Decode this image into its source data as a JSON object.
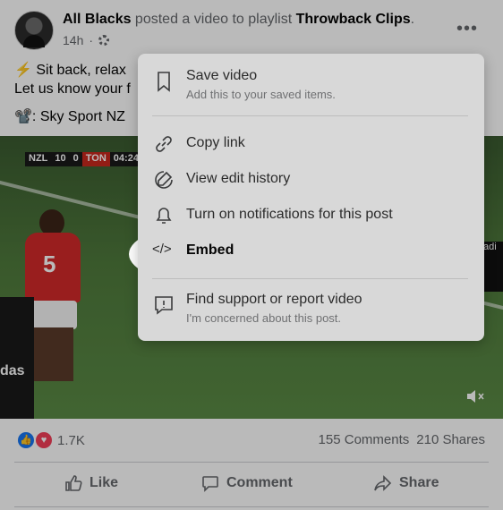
{
  "post": {
    "author": "All Blacks",
    "action_text": " posted a video to playlist ",
    "playlist": "Throwback Clips",
    "period": ".",
    "time": "14h",
    "more_label": "•••",
    "caption_line1_prefix": "⚡ Sit back, relax",
    "caption_line2": "Let us know your f",
    "credit_text": ": Sky Sport NZ",
    "credit_icon": "📽️"
  },
  "video": {
    "scoreboard": {
      "team1": "NZL",
      "score1": "10",
      "score2": "0",
      "team2": "TON",
      "clock": "04:24"
    },
    "player_number": "5",
    "ad_left": "das",
    "ad_right": "adi"
  },
  "footer": {
    "reaction_count": "1.7K",
    "comments": "155 Comments",
    "shares": "210 Shares",
    "like_label": "Like",
    "comment_label": "Comment",
    "share_label": "Share"
  },
  "menu": {
    "save": {
      "label": "Save video",
      "sub": "Add this to your saved items."
    },
    "copy_link": {
      "label": "Copy link"
    },
    "edit_history": {
      "label": "View edit history"
    },
    "notifications": {
      "label": "Turn on notifications for this post"
    },
    "embed": {
      "label": "Embed",
      "icon_glyph": "</>"
    },
    "report": {
      "label": "Find support or report video",
      "sub": "I'm concerned about this post."
    }
  },
  "icons": {
    "save": "bookmark-icon",
    "copy_link": "link-icon",
    "edit_history": "edit-history-icon",
    "notifications": "bell-icon",
    "embed": "code-icon",
    "report": "report-icon"
  },
  "colors": {
    "like_blue": "#1877f2",
    "love_red": "#f33e58",
    "menu_bg": "#d8d8d8",
    "highlight": "#ffffff"
  }
}
